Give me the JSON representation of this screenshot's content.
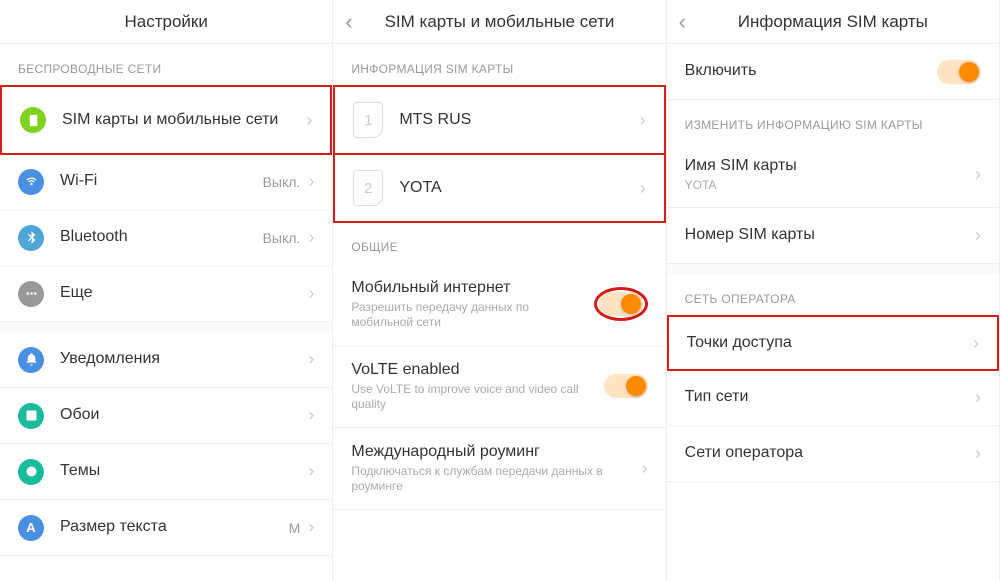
{
  "panel1": {
    "title": "Настройки",
    "section_wireless": "БЕСПРОВОДНЫЕ СЕТИ",
    "items": [
      {
        "label": "SIM карты и мобильные сети",
        "icon": "sim"
      },
      {
        "label": "Wi-Fi",
        "icon": "wifi",
        "value": "Выкл."
      },
      {
        "label": "Bluetooth",
        "icon": "bt",
        "value": "Выкл."
      },
      {
        "label": "Еще",
        "icon": "more"
      }
    ],
    "items2": [
      {
        "label": "Уведомления",
        "icon": "notif"
      },
      {
        "label": "Обои",
        "icon": "wall"
      },
      {
        "label": "Темы",
        "icon": "theme"
      },
      {
        "label": "Размер текста",
        "icon": "text",
        "value": "M"
      }
    ]
  },
  "panel2": {
    "title": "SIM карты и мобильные сети",
    "section_info": "ИНФОРМАЦИЯ SIM КАРТЫ",
    "sim1": "MTS RUS",
    "sim2": "YOTA",
    "section_common": "ОБЩИЕ",
    "mobile_data": {
      "label": "Мобильный интернет",
      "sub": "Разрешить передачу данных по мобильной сети"
    },
    "volte": {
      "label": "VoLTE enabled",
      "sub": "Use VoLTE to improve voice and video call quality"
    },
    "roaming": {
      "label": "Международный роуминг",
      "sub": "Подключаться к службам передачи данных в роуминге"
    }
  },
  "panel3": {
    "title": "Информация SIM карты",
    "enable": "Включить",
    "section_edit": "ИЗМЕНИТЬ ИНФОРМАЦИЮ SIM КАРТЫ",
    "sim_name": {
      "label": "Имя SIM карты",
      "sub": "YOTA"
    },
    "sim_number": "Номер SIM карты",
    "section_operator": "СЕТЬ ОПЕРАТОРА",
    "apn": "Точки доступа",
    "net_type": "Тип сети",
    "operator_nets": "Сети оператора"
  }
}
